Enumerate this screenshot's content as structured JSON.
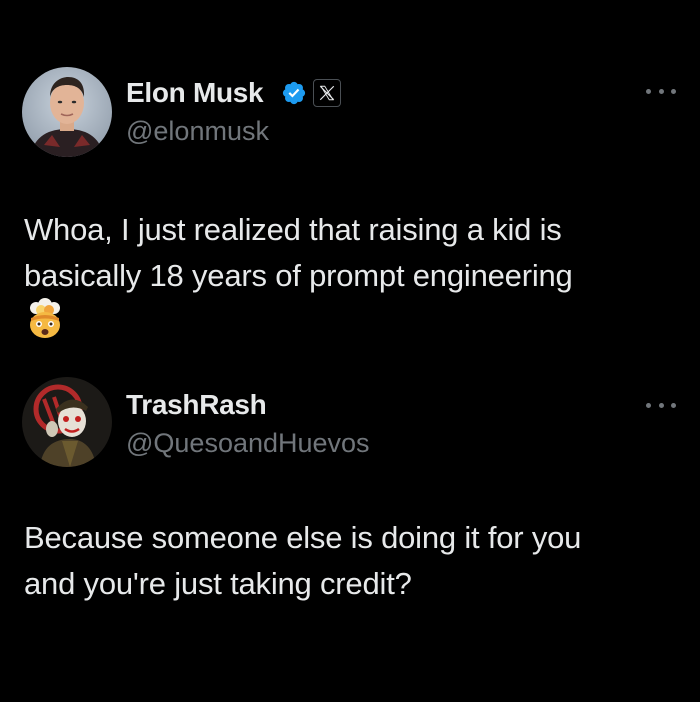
{
  "posts": [
    {
      "display_name": "Elon Musk",
      "handle": "@elonmusk",
      "verified_icon": "verified-badge-icon",
      "affiliate_icon": "x-logo-icon",
      "more_icon": "more-options-icon",
      "text_lines": [
        "Whoa, I just realized that raising a kid is",
        "basically 18 years of prompt engineering"
      ],
      "emoji": "exploding-head-emoji"
    },
    {
      "display_name": "TrashRash",
      "handle": "@QuesoandHuevos",
      "more_icon": "more-options-icon",
      "text_lines": [
        "Because someone else is doing it for you",
        "and you're just taking credit?"
      ]
    }
  ],
  "colors": {
    "background": "#000000",
    "primary_text": "#e7e9ea",
    "secondary_text": "#71767b",
    "verified_blue": "#1d9bf0"
  }
}
